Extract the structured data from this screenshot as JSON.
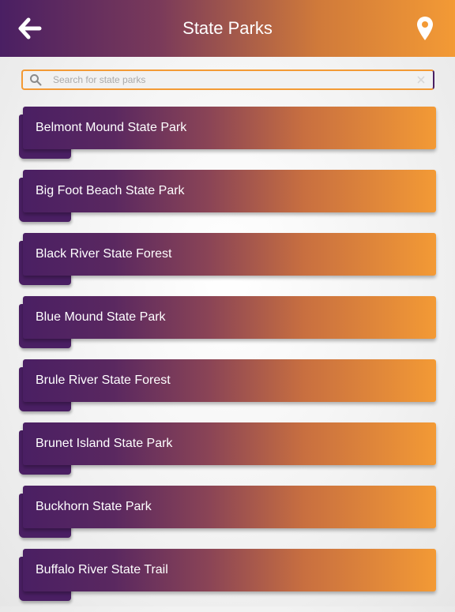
{
  "header": {
    "title": "State Parks",
    "back_icon": "arrow-left-icon",
    "location_icon": "map-pin-icon",
    "gradient_start": "#4a1f63",
    "gradient_end": "#f39a35"
  },
  "search": {
    "placeholder": "Search for state parks",
    "value": "",
    "search_icon": "search-icon",
    "clear_icon": "close-icon"
  },
  "parks": [
    "Belmont Mound State Park",
    "Big Foot Beach State Park",
    "Black River State Forest",
    "Blue Mound State Park",
    "Brule River State Forest",
    "Brunet Island State Park",
    "Buckhorn State Park",
    "Buffalo River State Trail"
  ],
  "colors": {
    "accent_purple": "#4a1f63",
    "accent_orange": "#f39a35"
  }
}
